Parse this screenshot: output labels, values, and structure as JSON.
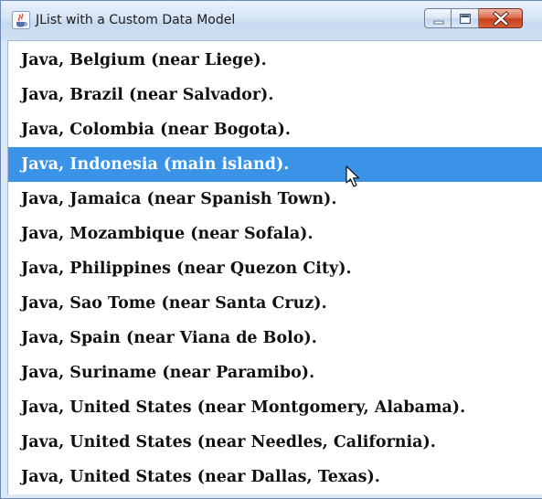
{
  "window": {
    "title": "JList with a Custom Data Model",
    "icon": "java-coffee-cup-icon",
    "controls": {
      "minimize": "minimize-icon",
      "maximize": "maximize-icon",
      "close": "close-icon"
    }
  },
  "list": {
    "selected_index": 3,
    "selection_color": "#3b93e8",
    "items": [
      {
        "label": "Java, Belgium (near Liege)."
      },
      {
        "label": "Java, Brazil (near Salvador)."
      },
      {
        "label": "Java, Colombia (near Bogota)."
      },
      {
        "label": "Java, Indonesia (main island)."
      },
      {
        "label": "Java, Jamaica (near Spanish Town)."
      },
      {
        "label": "Java, Mozambique (near Sofala)."
      },
      {
        "label": "Java, Philippines (near Quezon City)."
      },
      {
        "label": "Java, Sao Tome (near Santa Cruz)."
      },
      {
        "label": "Java, Spain (near Viana de Bolo)."
      },
      {
        "label": "Java, Suriname (near Paramibo)."
      },
      {
        "label": "Java, United States (near Montgomery, Alabama)."
      },
      {
        "label": "Java, United States (near Needles, California)."
      },
      {
        "label": "Java, United States (near Dallas, Texas)."
      }
    ]
  }
}
